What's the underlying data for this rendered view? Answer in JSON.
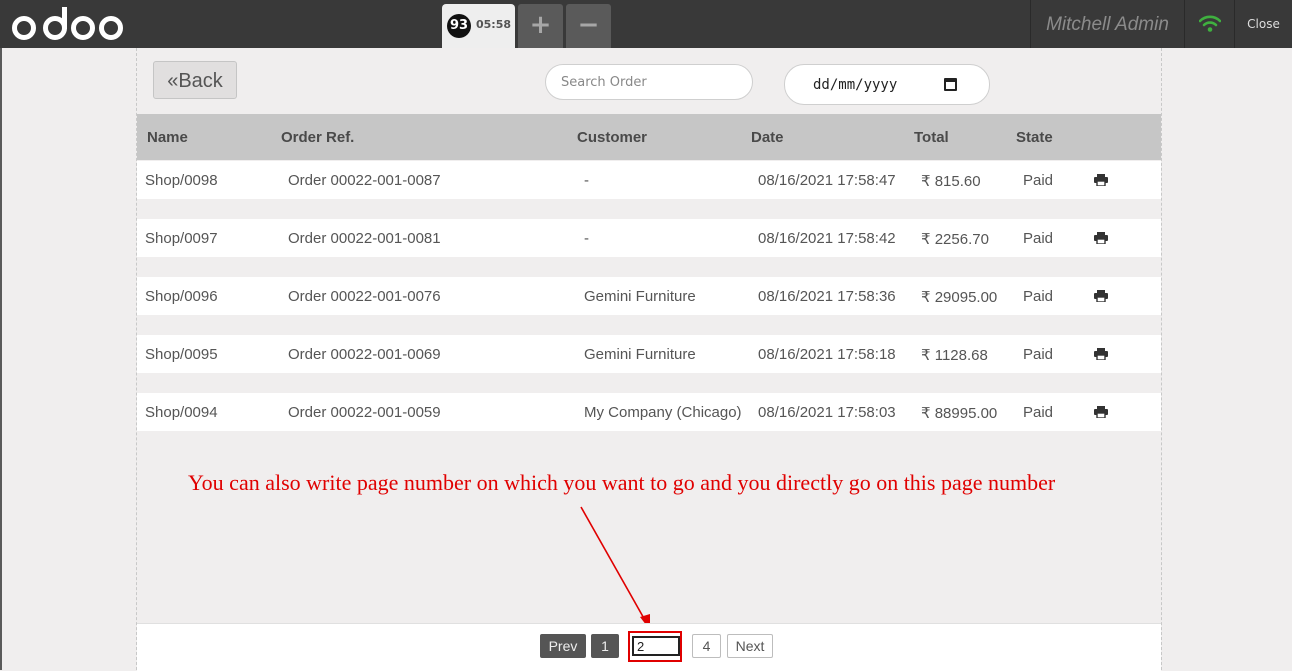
{
  "topbar": {
    "logo_text": "odoo",
    "ticket_number": "93",
    "ticket_time": "05:58",
    "add_order_icon": "plus-icon",
    "remove_order_icon": "minus-icon",
    "user_name": "Mitchell Admin",
    "connection_icon": "wifi-icon",
    "close_label": "Close"
  },
  "toolbar": {
    "back_label": "Back",
    "back_icon": "double-chevron-left-icon",
    "search_placeholder": "Search Order",
    "date_placeholder": "dd/mm/yyyy",
    "calendar_icon": "calendar-icon"
  },
  "table": {
    "columns": [
      "Name",
      "Order Ref.",
      "Customer",
      "Date",
      "Total",
      "State"
    ],
    "rows": [
      {
        "name": "Shop/0098",
        "ref": "Order 00022-001-0087",
        "customer": "-",
        "date": "08/16/2021 17:58:47",
        "total": "₹ 815.60",
        "state": "Paid"
      },
      {
        "name": "Shop/0097",
        "ref": "Order 00022-001-0081",
        "customer": "-",
        "date": "08/16/2021 17:58:42",
        "total": "₹ 2256.70",
        "state": "Paid"
      },
      {
        "name": "Shop/0096",
        "ref": "Order 00022-001-0076",
        "customer": "Gemini Furniture",
        "date": "08/16/2021 17:58:36",
        "total": "₹ 29095.00",
        "state": "Paid"
      },
      {
        "name": "Shop/0095",
        "ref": "Order 00022-001-0069",
        "customer": "Gemini Furniture",
        "date": "08/16/2021 17:58:18",
        "total": "₹ 1128.68",
        "state": "Paid"
      },
      {
        "name": "Shop/0094",
        "ref": "Order 00022-001-0059",
        "customer": "My Company (Chicago)",
        "date": "08/16/2021 17:58:03",
        "total": "₹ 88995.00",
        "state": "Paid"
      }
    ],
    "print_icon": "printer-icon"
  },
  "annotation": {
    "text": "You can also write page number on which you want to go and you directly go on this page number",
    "color": "#e00000"
  },
  "pagination": {
    "prev_label": "Prev",
    "page_1": "1",
    "page_input_value": "2",
    "page_4": "4",
    "next_label": "Next"
  }
}
